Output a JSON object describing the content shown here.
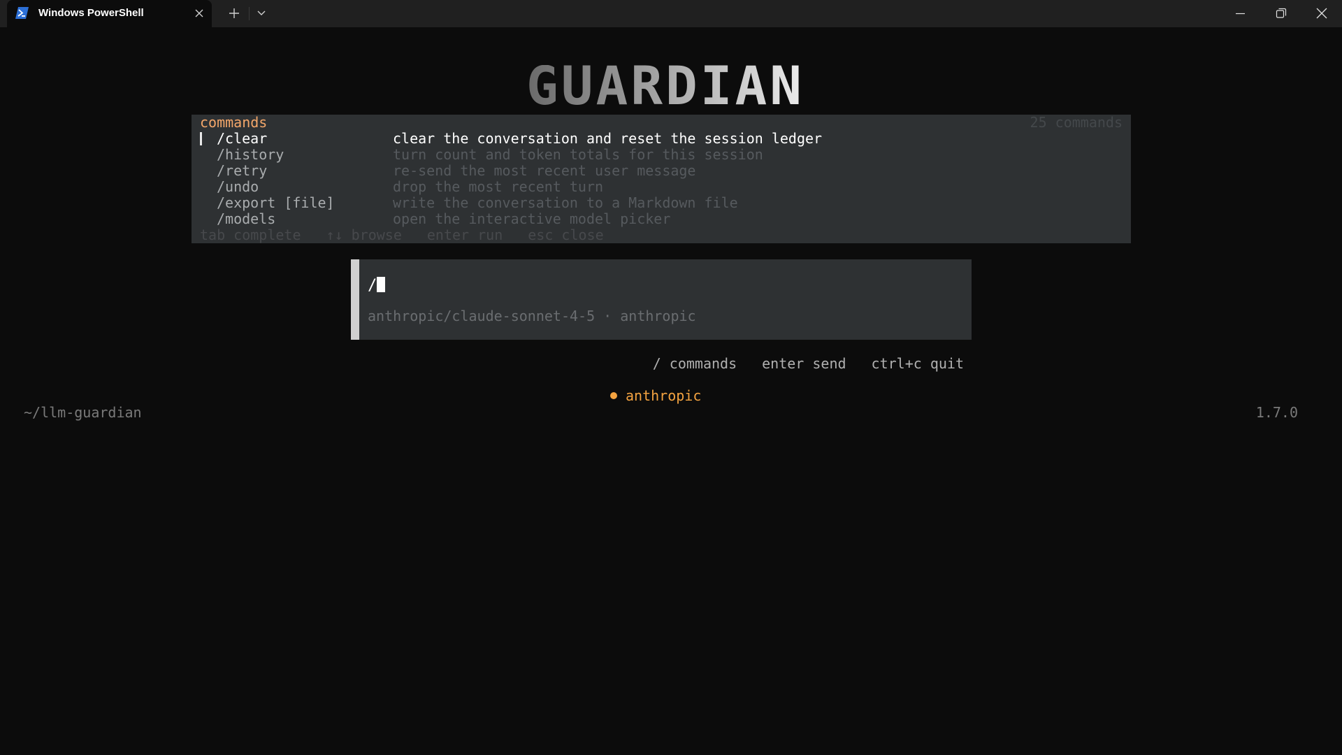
{
  "window": {
    "tab_title": "Windows PowerShell",
    "icons": {
      "tab": "powershell-icon",
      "close_tab": "close-icon",
      "new_tab": "plus-icon",
      "dropdown": "chevron-down-icon",
      "minimize": "minimize-icon",
      "restore": "restore-icon",
      "close": "close-icon"
    }
  },
  "logo": {
    "text": "GUARDIAN"
  },
  "palette": {
    "header": "commands",
    "count": "25 commands",
    "items": [
      {
        "name": "/clear",
        "desc": "clear the conversation and reset the session ledger",
        "selected": true
      },
      {
        "name": "/history",
        "desc": "turn count and token totals for this session",
        "selected": false
      },
      {
        "name": "/retry",
        "desc": "re-send the most recent user message",
        "selected": false
      },
      {
        "name": "/undo",
        "desc": "drop the most recent turn",
        "selected": false
      },
      {
        "name": "/export [file]",
        "desc": "write the conversation to a Markdown file",
        "selected": false
      },
      {
        "name": "/models",
        "desc": "open the interactive model picker",
        "selected": false
      }
    ],
    "hints": [
      "tab complete",
      "↑↓ browse",
      "enter run",
      "esc close"
    ]
  },
  "input": {
    "value": "/",
    "model_line": "anthropic/claude-sonnet-4-5 · anthropic"
  },
  "shortcuts": [
    "/ commands",
    "enter send",
    "ctrl+c quit"
  ],
  "status": {
    "provider": "anthropic",
    "cwd": "~/llm-guardian",
    "version": "1.7.0"
  },
  "colors": {
    "accent": "#f4a340",
    "palette_header": "#f4a76a",
    "terminal_bg": "#0c0c0c",
    "panel_bg": "#2e3133"
  }
}
